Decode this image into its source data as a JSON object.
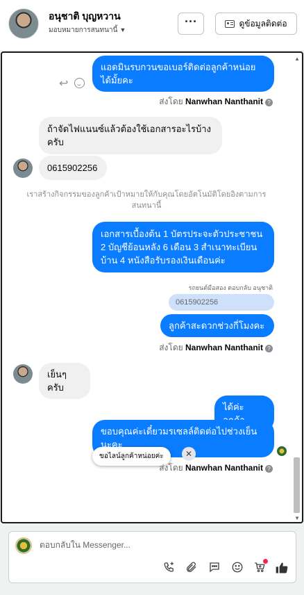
{
  "header": {
    "name": "อนุชาติ บุญหวาน",
    "assign_label": "มอบหมายการสนทนานี้",
    "more_label": "···",
    "contact_label": "ดูข้อมูลติดต่อ"
  },
  "sent_by_prefix": "ส่งโดย",
  "sender_name": "Nanwhan Nanthanit",
  "messages": {
    "m1": "แอดมินรบกวนขอเบอร์ติดต่อลูกค้าหน่อยได้มั้ยคะ",
    "m2": "ถ้าจัดไฟแนนซ์แล้วต้องใช้เอกสารอะไรบ้างครับ",
    "m3": "0615902256",
    "system": "เราสร้างกิจกรรมของลูกค้าเป้าหมายให้กับคุณโดยอัตโนมัติโดยอิงตามการสนทนานี้",
    "m4": "เอกสารเบื้องต้น 1 บัตรประจะตัวประชาชน 2 บัญชีย้อนหลัง 6 เดือน 3 สำเนาทะเบียนบ้าน 4 หนังสือรับรองเงินเดือนค่ะ",
    "reply_context": "รถยนต์มือสอง ตอบกลับ อนุชาติ",
    "quoted": "0615902256",
    "m5": "ลูกค้าสะดวกช่วงกี่โมงคะ",
    "m6": "เย็นๆครับ",
    "m7": "ได้ค่ะลูกค้า",
    "m8": "ขอบคุณค่ะเดี๋ยวมรเซลล์ติดต่อไปช่วงเย็นนะคะ",
    "tooltip": "ขอไลน์ลูกค้าหน่อยค่ะ"
  },
  "composer": {
    "placeholder": "ตอบกลับใน Messenger..."
  },
  "icons": {
    "call": "phone-plus-icon",
    "attach": "paperclip-icon",
    "saved_reply": "chat-bubble-icon",
    "emoji": "smile-icon",
    "cart": "cart-icon",
    "like": "thumbs-up-icon"
  },
  "colors": {
    "outgoing": "#0a7cff",
    "incoming": "#f0f0f0",
    "notification": "#f02849"
  }
}
